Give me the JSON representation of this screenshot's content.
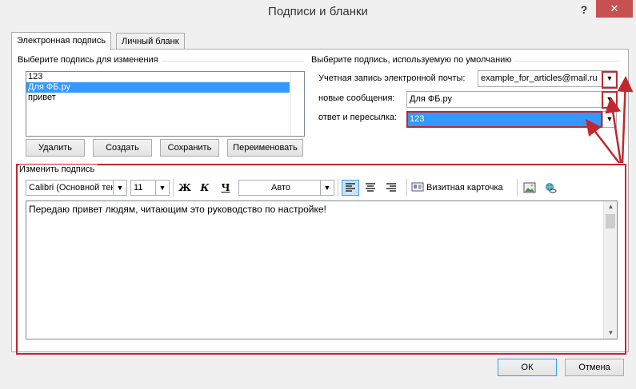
{
  "window": {
    "title": "Подписи и бланки",
    "help": "?",
    "close": "✕"
  },
  "tabs": [
    {
      "label": "Электронная подпись",
      "active": true
    },
    {
      "label": "Личный бланк",
      "active": false
    }
  ],
  "select_section": {
    "label": "Выберите подпись для изменения",
    "items": [
      "123",
      "Для ФБ.ру",
      "привет"
    ],
    "selected_index": 1
  },
  "default_section": {
    "label": "Выберите подпись, используемую по умолчанию",
    "account_label": "Учетная запись электронной почты:",
    "account_value": "example_for_articles@mail.ru",
    "new_msg_label": "новые сообщения:",
    "new_msg_value": "Для ФБ.ру",
    "reply_label": "ответ и пересылка:",
    "reply_value": "123"
  },
  "buttons": {
    "delete": "Удалить",
    "create": "Создать",
    "save": "Сохранить",
    "rename": "Переименовать",
    "ok": "ОК",
    "cancel": "Отмена"
  },
  "edit_section": {
    "label": "Изменить подпись",
    "font": "Calibri (Основной текс",
    "size": "11",
    "bold": "Ж",
    "italic": "К",
    "underline": "Ч",
    "color": "Авто",
    "business_card": "Визитная карточка",
    "body_text": "Передаю привет людям, читающим это руководство по настройке!"
  },
  "colors": {
    "annotation": "#c0282f",
    "selection": "#3399ff"
  }
}
